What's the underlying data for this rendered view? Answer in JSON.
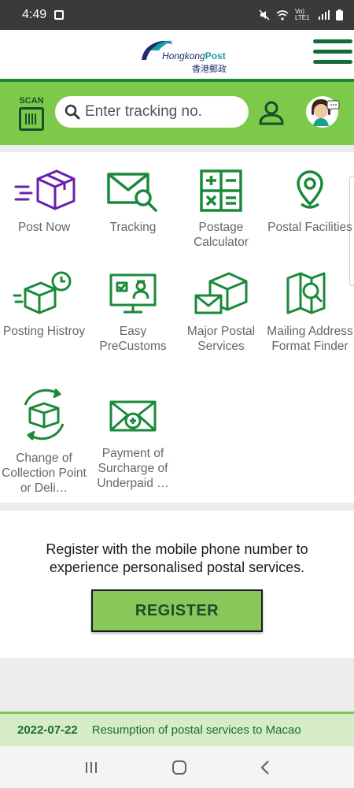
{
  "status_bar": {
    "time": "4:49",
    "network": "Vo) LTE1"
  },
  "header": {
    "logo_text": "Hongkong",
    "logo_bold": "Post",
    "logo_chinese": "香港郵政"
  },
  "search": {
    "scan_label": "SCAN",
    "placeholder": "Enter tracking no."
  },
  "services": [
    {
      "name": "post-now",
      "label": "Post Now",
      "icon": "parcel-box-icon"
    },
    {
      "name": "tracking",
      "label": "Tracking",
      "icon": "envelope-search-icon"
    },
    {
      "name": "postage-calculator",
      "label": "Postage Calculator",
      "icon": "calculator-icon"
    },
    {
      "name": "postal-facilities",
      "label": "Postal Facilities",
      "icon": "location-pin-icon"
    },
    {
      "name": "posting-history",
      "label": "Posting Histroy",
      "icon": "parcel-clock-icon"
    },
    {
      "name": "easy-precustoms",
      "label": "Easy PreCustoms",
      "icon": "monitor-officer-icon"
    },
    {
      "name": "major-postal-services",
      "label": "Major Postal Services",
      "icon": "mail-parcel-icon"
    },
    {
      "name": "mailing-address-format-finder",
      "label": "Mailing Address Format Finder",
      "icon": "map-search-icon"
    },
    {
      "name": "change-of-collection-point",
      "label": "Change of Collection Point or Deli…",
      "icon": "parcel-cycle-icon"
    },
    {
      "name": "payment-of-surcharge",
      "label": "Payment of Surcharge of Underpaid …",
      "icon": "envelope-coin-icon"
    }
  ],
  "register": {
    "message": "Register with the mobile phone number to experience personalised postal services.",
    "button_label": "REGISTER"
  },
  "news": {
    "date": "2022-07-22",
    "text": "Resumption of postal services to Macao"
  },
  "colors": {
    "brand_green": "#1a8a3a",
    "band_green": "#7dc94a",
    "purple": "#6a1fb0"
  }
}
